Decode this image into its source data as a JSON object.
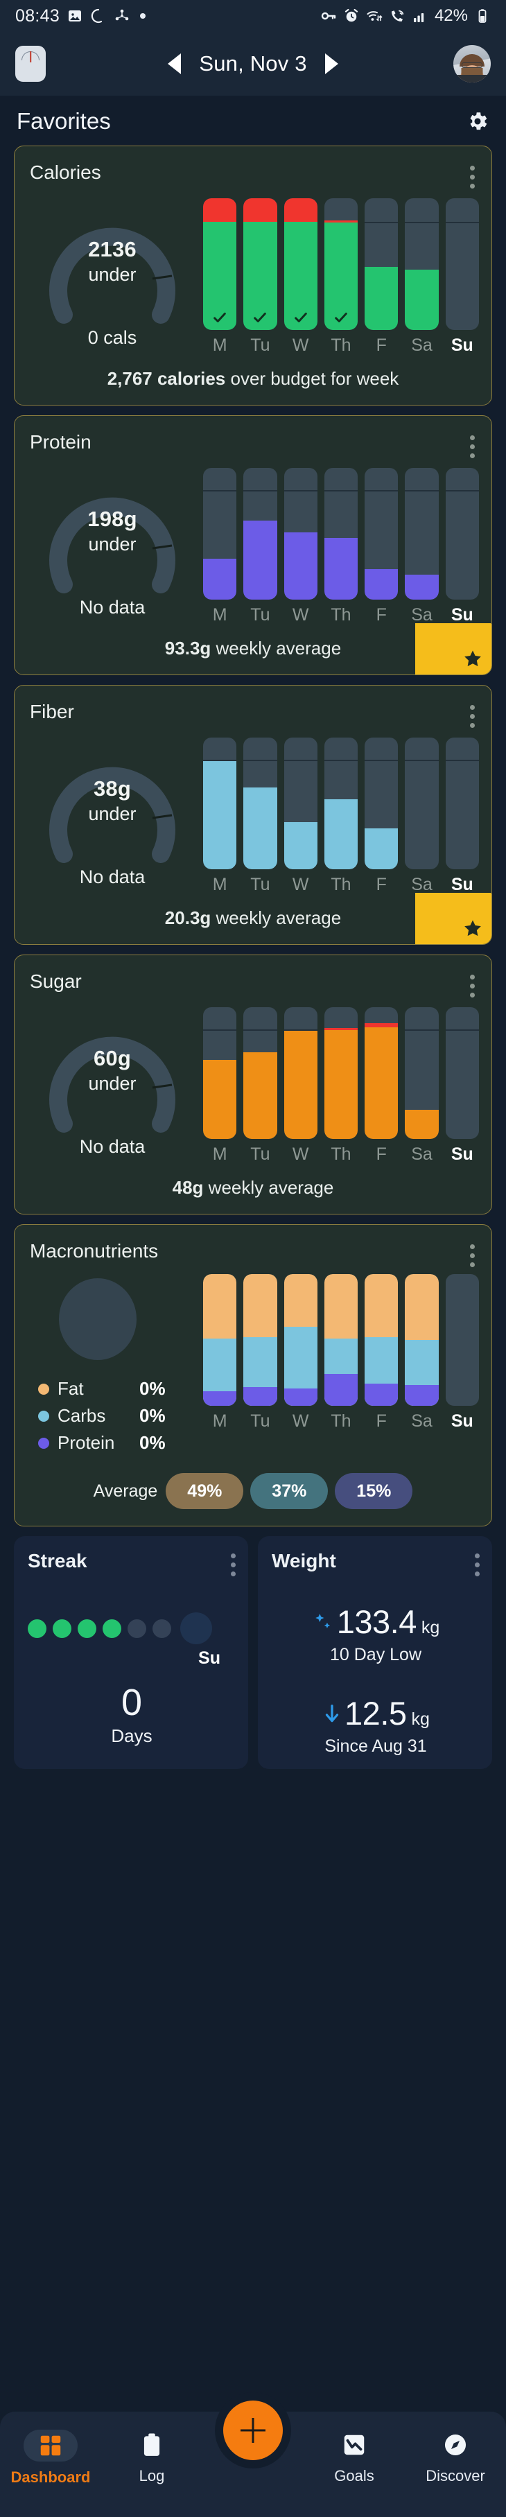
{
  "status_bar": {
    "time": "08:43",
    "battery": "42%",
    "icons": [
      "image-icon",
      "crescent-icon",
      "nodes-icon",
      "dot-icon",
      "key-icon",
      "alarm-icon",
      "wifi-transfer-icon",
      "call-wifi-icon",
      "signal-icon",
      "battery-icon"
    ]
  },
  "top_nav": {
    "scale_icon": "scale-icon",
    "prev_label": "previous-day",
    "date": "Sun, Nov 3",
    "next_label": "next-day",
    "avatar": "profile-avatar"
  },
  "favorites": {
    "title": "Favorites",
    "settings_icon": "gear-icon"
  },
  "days": [
    "M",
    "Tu",
    "W",
    "Th",
    "F",
    "Sa",
    "Su"
  ],
  "today_index": 6,
  "cards": [
    {
      "title": "Calories",
      "gauge_value": "2136",
      "gauge_sub": "under",
      "gauge_foot": "0 cals",
      "footer_bold": "2,767 calories",
      "footer_rest": " over budget for week",
      "starred": false,
      "bar_color": "#24c46f",
      "over_color": "#f0352e"
    },
    {
      "title": "Protein",
      "gauge_value": "198g",
      "gauge_sub": "under",
      "gauge_foot": "No data",
      "footer_bold": "93.3g",
      "footer_rest": " weekly average",
      "starred": true,
      "bar_color": "#6c5ce7",
      "over_color": "#f0352e"
    },
    {
      "title": "Fiber",
      "gauge_value": "38g",
      "gauge_sub": "under",
      "gauge_foot": "No data",
      "footer_bold": "20.3g",
      "footer_rest": " weekly average",
      "starred": true,
      "bar_color": "#7cc5de",
      "over_color": "#f0352e"
    },
    {
      "title": "Sugar",
      "gauge_value": "60g",
      "gauge_sub": "under",
      "gauge_foot": "No data",
      "footer_bold": "48g",
      "footer_rest": " weekly average",
      "starred": false,
      "bar_color": "#ef8f16",
      "over_color": "#f0352e"
    }
  ],
  "macronutrients": {
    "title": "Macronutrients",
    "legend": [
      {
        "name": "Fat",
        "pct": "0%",
        "color": "#f3b873"
      },
      {
        "name": "Carbs",
        "pct": "0%",
        "color": "#7cc5de"
      },
      {
        "name": "Protein",
        "pct": "0%",
        "color": "#6c5ce7"
      }
    ],
    "average_label": "Average",
    "average_pills": [
      {
        "value": "49%",
        "color": "#8a7350"
      },
      {
        "value": "37%",
        "color": "#44737e"
      },
      {
        "value": "15%",
        "color": "#464e7e"
      }
    ]
  },
  "streak": {
    "title": "Streak",
    "today_label": "Su",
    "count": "0",
    "unit": "Days",
    "dots": [
      "on",
      "on",
      "on",
      "on",
      "off",
      "off",
      "today"
    ]
  },
  "weight": {
    "title": "Weight",
    "sparkle_icon": "sparkle-icon",
    "value": "133.4",
    "unit": "kg",
    "note": "10 Day Low",
    "down_icon": "down-arrow-icon",
    "change_value": "12.5",
    "change_unit": "kg",
    "change_note": "Since Aug 31"
  },
  "bottom_nav": {
    "fab_icon": "plus-icon",
    "items": [
      {
        "label": "Dashboard",
        "icon": "dashboard-icon",
        "active": true
      },
      {
        "label": "Log",
        "icon": "clipboard-icon",
        "active": false
      },
      {
        "label": "Goals",
        "icon": "chart-down-icon",
        "active": false
      },
      {
        "label": "Discover",
        "icon": "compass-icon",
        "active": false
      }
    ]
  },
  "chart_data": [
    {
      "type": "bar",
      "title": "Calories",
      "categories": [
        "M",
        "Tu",
        "W",
        "Th",
        "F",
        "Sa",
        "Su"
      ],
      "values": [
        112,
        112,
        112,
        100,
        58,
        56,
        0
      ],
      "goal_line_pct": [
        82,
        82,
        82,
        82,
        82,
        82,
        82
      ],
      "over_budget": [
        true,
        true,
        true,
        true,
        false,
        false,
        false
      ],
      "checkmarks": [
        true,
        true,
        true,
        true,
        false,
        false,
        false
      ],
      "ylabel": "% of goal",
      "unit": "cals"
    },
    {
      "type": "bar",
      "title": "Protein",
      "categories": [
        "M",
        "Tu",
        "W",
        "Th",
        "F",
        "Sa",
        "Su"
      ],
      "values": [
        31,
        60,
        51,
        47,
        23,
        19,
        0
      ],
      "goal_line_pct": [
        83,
        83,
        83,
        83,
        83,
        83,
        83
      ],
      "ylabel": "% of goal",
      "unit": "g"
    },
    {
      "type": "bar",
      "title": "Fiber",
      "categories": [
        "M",
        "Tu",
        "W",
        "Th",
        "F",
        "Sa",
        "Su"
      ],
      "values": [
        82,
        62,
        36,
        53,
        31,
        0,
        0
      ],
      "goal_line_pct": [
        82,
        82,
        82,
        82,
        82,
        82,
        82
      ],
      "ylabel": "% of goal",
      "unit": "g"
    },
    {
      "type": "bar",
      "title": "Sugar",
      "categories": [
        "M",
        "Tu",
        "W",
        "Th",
        "F",
        "Sa",
        "Su"
      ],
      "values": [
        60,
        66,
        82,
        84,
        86,
        22,
        0
      ],
      "goal_line_pct": [
        82,
        82,
        82,
        82,
        82,
        82,
        82
      ],
      "over_budget": [
        false,
        false,
        false,
        true,
        true,
        false,
        false
      ],
      "ylabel": "% of goal",
      "unit": "g"
    },
    {
      "type": "bar",
      "title": "Macronutrients",
      "stacked": true,
      "categories": [
        "M",
        "Tu",
        "W",
        "Th",
        "F",
        "Sa",
        "Su"
      ],
      "series": [
        {
          "name": "Protein",
          "color": "#6c5ce7",
          "values": [
            11,
            14,
            13,
            24,
            17,
            16,
            0
          ]
        },
        {
          "name": "Carbs",
          "color": "#7cc5de",
          "values": [
            40,
            38,
            47,
            27,
            35,
            34,
            0
          ]
        },
        {
          "name": "Fat",
          "color": "#f3b873",
          "values": [
            49,
            48,
            40,
            49,
            48,
            50,
            0
          ]
        }
      ],
      "averages": {
        "Fat": 49,
        "Carbs": 37,
        "Protein": 15
      }
    }
  ]
}
